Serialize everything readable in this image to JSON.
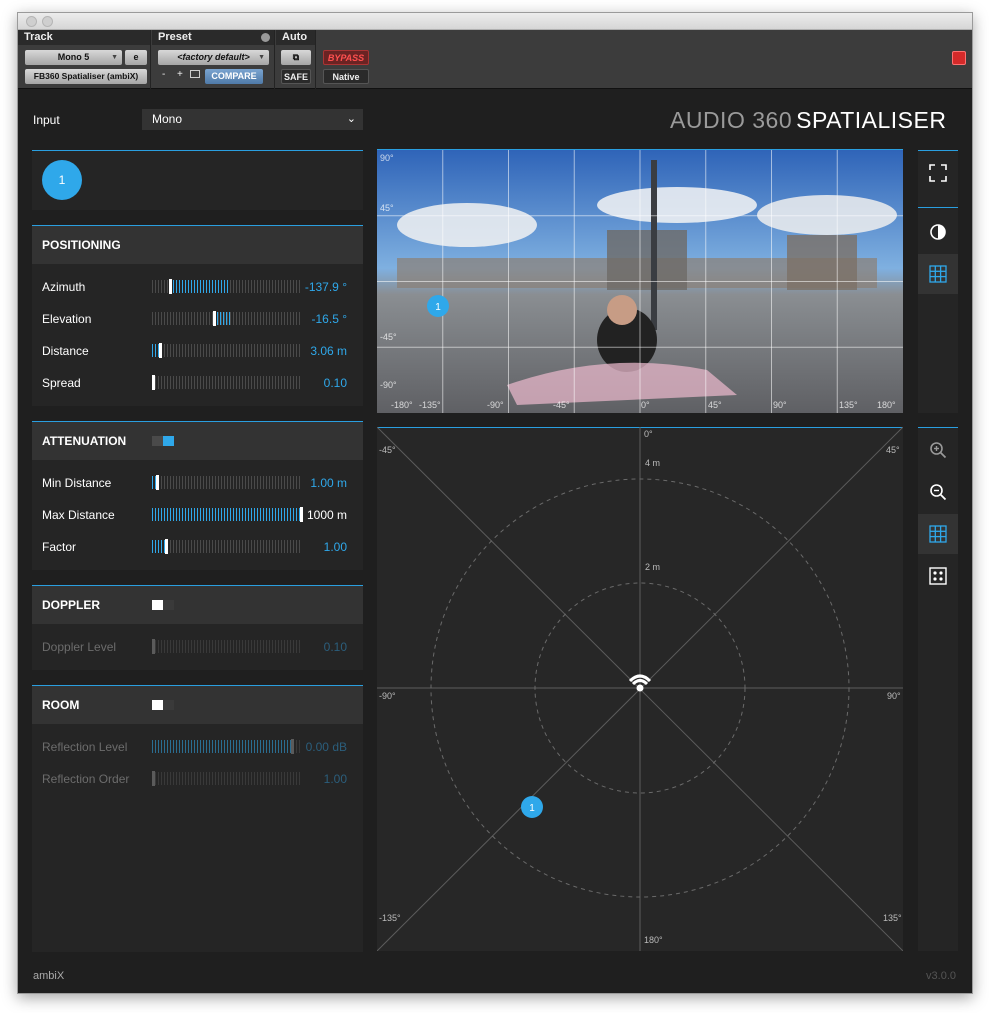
{
  "host": {
    "track_label": "Track",
    "preset_label": "Preset",
    "auto_label": "Auto",
    "track_name": "Mono 5",
    "track_e": "e",
    "plugin_name": "FB360 Spatialiser (ambiX)",
    "preset_value": "<factory default>",
    "minus": "-",
    "plus": "+",
    "compare": "COMPARE",
    "safe": "SAFE",
    "bypass": "BYPASS",
    "native": "Native"
  },
  "input": {
    "label": "Input",
    "value": "Mono"
  },
  "logo": {
    "part1": "AUDIO 360",
    "part2": "SPATIALISER"
  },
  "source": {
    "badge": "1"
  },
  "positioning": {
    "title": "POSITIONING",
    "rows": [
      {
        "label": "Azimuth",
        "value": "-137.9 °"
      },
      {
        "label": "Elevation",
        "value": "-16.5 °"
      },
      {
        "label": "Distance",
        "value": "3.06 m"
      },
      {
        "label": "Spread",
        "value": "0.10"
      }
    ]
  },
  "attenuation": {
    "title": "ATTENUATION",
    "rows": [
      {
        "label": "Min Distance",
        "value": "1.00 m"
      },
      {
        "label": "Max Distance",
        "value": "1000 m"
      },
      {
        "label": "Factor",
        "value": "1.00"
      }
    ]
  },
  "doppler": {
    "title": "DOPPLER",
    "rows": [
      {
        "label": "Doppler Level",
        "value": "0.10"
      }
    ]
  },
  "room": {
    "title": "ROOM",
    "rows": [
      {
        "label": "Reflection Level",
        "value": "0.00 dB"
      },
      {
        "label": "Reflection Order",
        "value": "1.00"
      }
    ]
  },
  "video_labels": {
    "lat": [
      "90°",
      "45°",
      "-45°",
      "-90°"
    ],
    "lon": [
      "-180°",
      "-135°",
      "-90°",
      "-45°",
      "0°",
      "45°",
      "90°",
      "135°",
      "180°"
    ]
  },
  "topdown": {
    "angles": {
      "top": "0°",
      "bottom": "180°",
      "left": "-90°",
      "right": "90°",
      "tl": "-45°",
      "tr": "45°",
      "bl": "-135°",
      "br": "135°"
    },
    "rings": [
      "4 m",
      "2 m"
    ]
  },
  "footer": {
    "left": "ambiX",
    "right": "v3.0.0"
  },
  "colors": {
    "accent": "#2fa8ea",
    "background": "#1f1f1f"
  }
}
